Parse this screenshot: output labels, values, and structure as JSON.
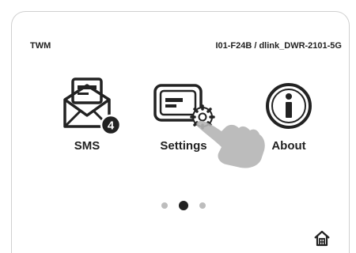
{
  "status": {
    "carrier": "TWM",
    "network": "I01-F24B / dlink_DWR-2101-5G"
  },
  "tiles": [
    {
      "label": "SMS",
      "icon": "envelope-icon",
      "badge": "4"
    },
    {
      "label": "Settings",
      "icon": "settings-icon"
    },
    {
      "label": "About",
      "icon": "info-icon"
    }
  ],
  "pager": {
    "pages": 3,
    "current": 2
  },
  "home": {
    "icon": "home-icon"
  },
  "colors": {
    "ink": "#222222",
    "muted": "#bdbdbd",
    "hand": "#b5b5b5"
  }
}
